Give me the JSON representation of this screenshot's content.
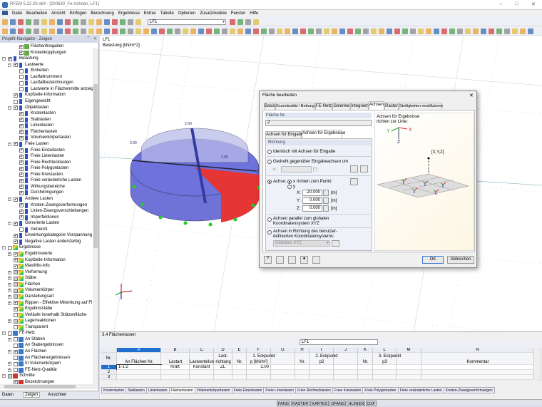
{
  "window": {
    "title": "RFEM 5.22.03 x64 - [200630_Fe-Achsen, LF1]"
  },
  "menu": [
    "Datei",
    "Bearbeiten",
    "Ansicht",
    "Einfügen",
    "Berechnung",
    "Ergebnisse",
    "Extras",
    "Tabelle",
    "Optionen",
    "Zusatzmodule",
    "Fenster",
    "Hilfe"
  ],
  "toolbar": {
    "loadcase": "LF1"
  },
  "navigator": {
    "title": "Projekt-Navigator - Zeigen",
    "items": [
      {
        "l": 2,
        "label": "Flächenfreigaben",
        "c": 1,
        "i": "check"
      },
      {
        "l": 2,
        "label": "Knotenkopplungen",
        "c": 1,
        "i": "check"
      },
      {
        "l": 0,
        "label": "Belastung",
        "c": 1,
        "i": "load",
        "e": 1
      },
      {
        "l": 1,
        "label": "Lastwerte",
        "c": 1,
        "i": "load",
        "e": 1
      },
      {
        "l": 2,
        "label": "Einheiten",
        "c": 0,
        "i": "load"
      },
      {
        "l": 2,
        "label": "Lastfallnummern",
        "c": 0,
        "i": "load"
      },
      {
        "l": 2,
        "label": "Lastfallbezeichnungen",
        "c": 0,
        "i": "load"
      },
      {
        "l": 2,
        "label": "Lastwerte in Flächenmitte anzeig",
        "c": 0,
        "i": "load"
      },
      {
        "l": 1,
        "label": "Kopfzeile-Information",
        "c": 1,
        "i": "load"
      },
      {
        "l": 1,
        "label": "Eigengewicht",
        "c": 0,
        "i": "load"
      },
      {
        "l": 1,
        "label": "Objektlasten",
        "c": 1,
        "i": "load",
        "e": 1
      },
      {
        "l": 2,
        "label": "Knotenlasten",
        "c": 1,
        "i": "load"
      },
      {
        "l": 2,
        "label": "Stablasten",
        "c": 1,
        "i": "load"
      },
      {
        "l": 2,
        "label": "Linienlasten",
        "c": 1,
        "i": "load"
      },
      {
        "l": 2,
        "label": "Flächenlasten",
        "c": 1,
        "i": "load"
      },
      {
        "l": 2,
        "label": "Volumenkörperlasten",
        "c": 1,
        "i": "load"
      },
      {
        "l": 1,
        "label": "Freie Lasten",
        "c": 1,
        "i": "load",
        "e": 1
      },
      {
        "l": 2,
        "label": "Freie Einzellasten",
        "c": 1,
        "i": "load"
      },
      {
        "l": 2,
        "label": "Freie Linienlasten",
        "c": 1,
        "i": "load"
      },
      {
        "l": 2,
        "label": "Freie Rechtecklasten",
        "c": 1,
        "i": "load"
      },
      {
        "l": 2,
        "label": "Freie Polygonlasten",
        "c": 1,
        "i": "load"
      },
      {
        "l": 2,
        "label": "Freie Kreislasten",
        "c": 1,
        "i": "load"
      },
      {
        "l": 2,
        "label": "Freie veränderliche Lasten",
        "c": 1,
        "i": "load"
      },
      {
        "l": 2,
        "label": "Wirkungsbereiche",
        "c": 1,
        "i": "load"
      },
      {
        "l": 2,
        "label": "Durchdringungen",
        "c": 1,
        "i": "load"
      },
      {
        "l": 1,
        "label": "Andere Lasten",
        "c": 1,
        "i": "load",
        "e": 1
      },
      {
        "l": 2,
        "label": "Knoten-Zwangsverformungen",
        "c": 1,
        "i": "load"
      },
      {
        "l": 2,
        "label": "Linien-Zwangsverschiebungen",
        "c": 1,
        "i": "load"
      },
      {
        "l": 2,
        "label": "Imperfektionen",
        "c": 1,
        "i": "load"
      },
      {
        "l": 1,
        "label": "Generierte Lasten",
        "c": 1,
        "i": "load",
        "e": 1
      },
      {
        "l": 2,
        "label": "Getrennt",
        "c": 0,
        "i": "load"
      },
      {
        "l": 1,
        "label": "Einwirkungskategorie Vorspannung",
        "c": 1,
        "i": "load"
      },
      {
        "l": 1,
        "label": "Negative Lasten andersfarbig",
        "c": 1,
        "i": "load"
      },
      {
        "l": 0,
        "label": "Ergebnisse",
        "c": 0,
        "i": "result",
        "e": 1
      },
      {
        "l": 1,
        "label": "Ergebniswerte",
        "c": 1,
        "i": "result",
        "e": 2
      },
      {
        "l": 1,
        "label": "Kopfzeile-Information",
        "c": 1,
        "i": "result"
      },
      {
        "l": 1,
        "label": "Max/Min-Info",
        "c": 1,
        "i": "result"
      },
      {
        "l": 1,
        "label": "Verformung",
        "c": 2,
        "i": "result",
        "e": 2
      },
      {
        "l": 1,
        "label": "Stäbe",
        "c": 2,
        "i": "result",
        "e": 2
      },
      {
        "l": 1,
        "label": "Flächen",
        "c": 2,
        "i": "result",
        "e": 2
      },
      {
        "l": 1,
        "label": "Volumenkörper",
        "c": 2,
        "i": "result",
        "e": 2
      },
      {
        "l": 1,
        "label": "Darstellungsart",
        "c": 2,
        "i": "result",
        "e": 2
      },
      {
        "l": 1,
        "label": "Rippen - Effektive Mitwirkung auf Fl",
        "c": 1,
        "i": "result",
        "e": 2
      },
      {
        "l": 1,
        "label": "Ergebnisstäbe",
        "c": 1,
        "i": "result"
      },
      {
        "l": 1,
        "label": "Verläufe innerhalb Stützenfläche",
        "c": 0,
        "i": "result"
      },
      {
        "l": 1,
        "label": "Lagerreaktionen",
        "c": 2,
        "i": "result",
        "e": 2
      },
      {
        "l": 1,
        "label": "Transparent",
        "c": 0,
        "i": "result"
      },
      {
        "l": 0,
        "label": "FE-Netz",
        "c": 0,
        "i": "mesh",
        "e": 1
      },
      {
        "l": 1,
        "label": "An Stäben",
        "c": 0,
        "i": "mesh",
        "e": 2
      },
      {
        "l": 1,
        "label": "An Stabergebnissen",
        "c": 0,
        "i": "mesh"
      },
      {
        "l": 1,
        "label": "An Flächen",
        "c": 1,
        "i": "mesh",
        "e": 2
      },
      {
        "l": 1,
        "label": "An Flächenergebnissen",
        "c": 0,
        "i": "mesh"
      },
      {
        "l": 1,
        "label": "In Volumenkörpern",
        "c": 0,
        "i": "mesh",
        "e": 2
      },
      {
        "l": 1,
        "label": "FE-Netz-Qualität",
        "c": 0,
        "i": "mesh",
        "e": 2
      },
      {
        "l": 0,
        "label": "Schnitte",
        "c": 2,
        "i": "section",
        "e": 1
      },
      {
        "l": 1,
        "label": "Bezeichnungen",
        "c": 1,
        "i": "section"
      }
    ],
    "tabs": [
      "Daten",
      "Zeigen",
      "Ansichten"
    ]
  },
  "view": {
    "title": "LF1",
    "subtitle": "Belastung [kN/m^2]",
    "load_labels": [
      "2.00",
      "2.00",
      "2.00"
    ]
  },
  "dialog": {
    "title": "Fläche bearbeiten",
    "tabs": [
      "Basis",
      "Exzentrizität / Bettung",
      "FE-Netz",
      "Gelenke",
      "Integriert",
      "Achsen",
      "Raster",
      "Steifigkeiten modifizieren"
    ],
    "active_tab": "Achsen",
    "surface_label": "Fläche Nr.",
    "surface_no": "2",
    "subtabs": [
      "Achsen für Eingabe",
      "Achsen für Ergebnisse"
    ],
    "group": "Richtung",
    "opt_identical": "Identisch mit Achsen für Eingabe",
    "opt_rotated": "Gedreht gegenüber Eingabeachsen um",
    "alpha_label": "α :",
    "alpha_unit": "[°]",
    "opt_axis": "Achse:",
    "axis_x": "x",
    "axis_y": "y",
    "point_label": "richten zum Punkt:",
    "x_label": "X:",
    "x_val": "-20.000",
    "y_label": "Y:",
    "y_val": "0.000",
    "z_label": "Z:",
    "z_val": "0.000",
    "unit": "[m]",
    "opt_parallel_1": "Achsen parallel zum globalen",
    "opt_parallel_2": "Koordinatensystem XYZ",
    "opt_user_1": "Achsen in Richtung des benutzer-",
    "opt_user_2": "definierten Koordinatensystems:",
    "cs_select": "Globales XYZ",
    "preview_1": "Achsen für Ergebnisse",
    "preview_2": "richten zur Linie:",
    "preview_point": "[X,Y,Z]",
    "ax_x": "X",
    "ax_y": "Y",
    "ax_z": "Z",
    "ok": "OK",
    "cancel": "Abbrechen"
  },
  "table": {
    "title": "3.4 Flächenlasten",
    "loadcase": "LF1",
    "letters": [
      "A",
      "B",
      "C",
      "D",
      "E",
      "F",
      "G",
      "H",
      "I",
      "J",
      "K",
      "L",
      "M",
      "N"
    ],
    "nr": "Nr.",
    "h_a": "An Flächen Nr.",
    "h_b": "Lastart",
    "h_c": "Lastverteilung",
    "h_d1": "Last-",
    "h_d2": "richtung",
    "h_e": "Nr.",
    "h_f": "p [kN/m²]",
    "h_ef": "1. Eckpunkt",
    "h_h": "Nr.",
    "h_i": "p2",
    "h_hi": "2. Eckpunkt",
    "h_k": "Nr.",
    "h_l": "p3",
    "h_kl": "3. Eckpunkt",
    "h_n": "Kommentar",
    "rows": [
      {
        "nr": "1",
        "a": "1-1:2",
        "b": "Kraft",
        "c": "Konstant",
        "d": "ZL",
        "f": "2.00"
      },
      {
        "nr": "2"
      },
      {
        "nr": "3"
      }
    ],
    "sheets": [
      "Knotenlasten",
      "Stablasten",
      "Linienlasten",
      "Flächenlasten",
      "Volumenkörperlasten",
      "Freie Einzellasten",
      "Freie Linienlasten",
      "Freie Rechtecklasten",
      "Freie Kreislasten",
      "Freie Polygonlasten",
      "Freie veränderliche Lasten",
      "Knoten-Zwangsverformungen"
    ],
    "active_sheet": "Flächenlasten"
  },
  "status": [
    "FANG",
    "RASTER",
    "KARTES",
    "OFANG",
    "HLINIEN",
    "DXF"
  ]
}
